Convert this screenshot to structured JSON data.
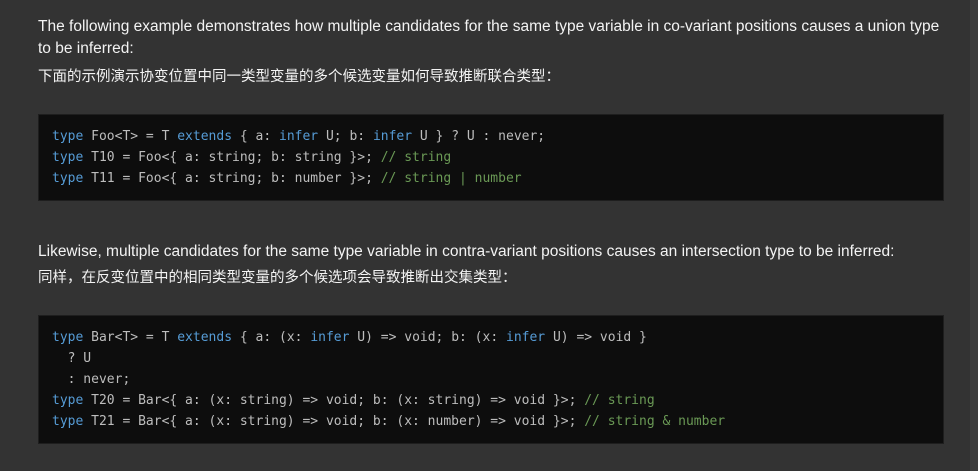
{
  "section1": {
    "paragraph_en": "The following example demonstrates how multiple candidates for the same type variable in co-variant positions causes a union type to be inferred:",
    "paragraph_cn": "下面的示例演示协变位置中同一类型变量的多个候选变量如何导致推断联合类型：",
    "code": [
      [
        [
          "kw",
          "type"
        ],
        [
          "tx",
          " Foo<T> = T "
        ],
        [
          "kw",
          "extends"
        ],
        [
          "tx",
          " { a: "
        ],
        [
          "kw",
          "infer"
        ],
        [
          "tx",
          " U; b: "
        ],
        [
          "kw",
          "infer"
        ],
        [
          "tx",
          " U } ? U : never;"
        ]
      ],
      [
        [
          "kw",
          "type"
        ],
        [
          "tx",
          " T10 = Foo<{ a: string; b: string }>; "
        ],
        [
          "cm",
          "// string"
        ]
      ],
      [
        [
          "kw",
          "type"
        ],
        [
          "tx",
          " T11 = Foo<{ a: string; b: number }>; "
        ],
        [
          "cm",
          "// string | number"
        ]
      ]
    ]
  },
  "section2": {
    "paragraph_en": "Likewise, multiple candidates for the same type variable in contra-variant positions causes an intersection type to be inferred:",
    "paragraph_cn": "同样，在反变位置中的相同类型变量的多个候选项会导致推断出交集类型：",
    "code": [
      [
        [
          "kw",
          "type"
        ],
        [
          "tx",
          " Bar<T> = T "
        ],
        [
          "kw",
          "extends"
        ],
        [
          "tx",
          " { a: (x: "
        ],
        [
          "kw",
          "infer"
        ],
        [
          "tx",
          " U) => void; b: (x: "
        ],
        [
          "kw",
          "infer"
        ],
        [
          "tx",
          " U) => void }"
        ]
      ],
      [
        [
          "tx",
          "  ? U"
        ]
      ],
      [
        [
          "tx",
          "  : never;"
        ]
      ],
      [
        [
          "kw",
          "type"
        ],
        [
          "tx",
          " T20 = Bar<{ a: (x: string) => void; b: (x: string) => void }>; "
        ],
        [
          "cm",
          "// string"
        ]
      ],
      [
        [
          "kw",
          "type"
        ],
        [
          "tx",
          " T21 = Bar<{ a: (x: string) => void; b: (x: number) => void }>; "
        ],
        [
          "cm",
          "// string & number"
        ]
      ]
    ]
  },
  "colors": {
    "background": "#333333",
    "code_background": "#0d0d0d",
    "keyword": "#569cd6",
    "comment": "#6a9955",
    "code_text": "#bdbdbd"
  }
}
